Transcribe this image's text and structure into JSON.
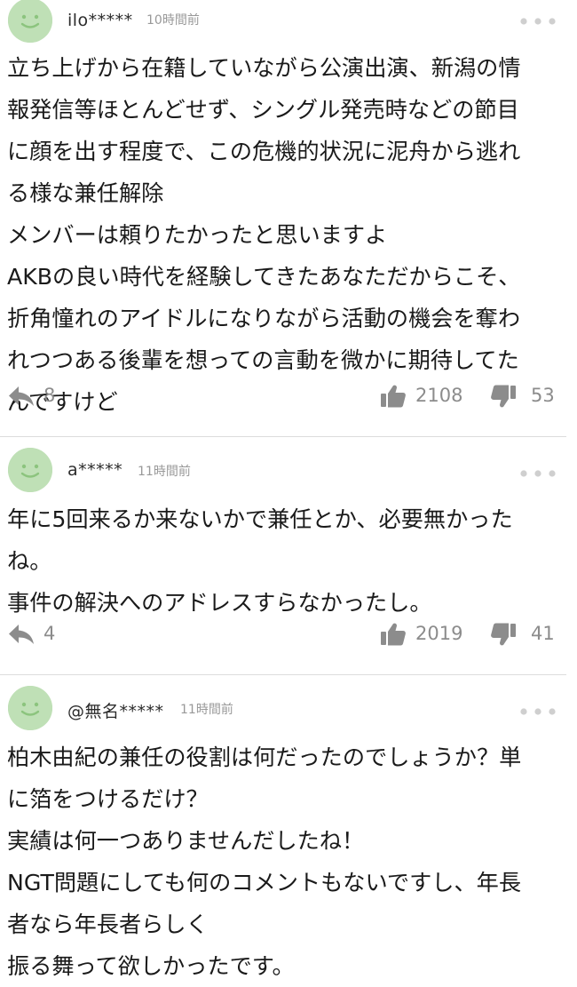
{
  "comments": [
    {
      "author": "ilo*****",
      "time": "10時間前",
      "lines": [
        "立ち上げから在籍していながら公演出演、新潟の情",
        "報発信等ほとんどせず、シングル発売時などの節目",
        "に顔を出す程度で、この危機的状況に泥舟から逃れ",
        "る様な兼任解除",
        "メンバーは頼りたかったと思いますよ",
        "AKBの良い時代を経験してきたあなただからこそ、",
        "折角憧れのアイドルになりながら活動の機会を奪わ",
        "れつつある後輩を想っての言動を微かに期待してた",
        "んですけど"
      ],
      "replies": "8",
      "likes": "2108",
      "dislikes": "53"
    },
    {
      "author": "a*****",
      "time": "11時間前",
      "lines": [
        "年に5回来るか来ないかで兼任とか、必要無かった",
        "ね。",
        "事件の解決へのアドレスすらなかったし。"
      ],
      "replies": "4",
      "likes": "2019",
      "dislikes": "41"
    },
    {
      "author": "@無名*****",
      "time": "11時間前",
      "lines": [
        "柏木由紀の兼任の役割は何だったのでしょうか？単",
        "に箔をつけるだけ？",
        "実績は何一つありませんだしたね！",
        "NGT問題にしても何のコメントもないですし、年長",
        "者なら年長者らしく",
        "振る舞って欲しかったです。"
      ]
    }
  ],
  "icons": {
    "avatar": "smiley-avatar-icon",
    "more": "more-dots-icon",
    "reply": "reply-arrow-icon",
    "like": "thumbs-up-icon",
    "dislike": "thumbs-down-icon"
  },
  "colors": {
    "avatar_bg": "#bfe0b6",
    "avatar_face": "#8cc47e",
    "icon": "#8c8c8c",
    "meta_text": "#999999",
    "divider": "#dcdcdc"
  }
}
